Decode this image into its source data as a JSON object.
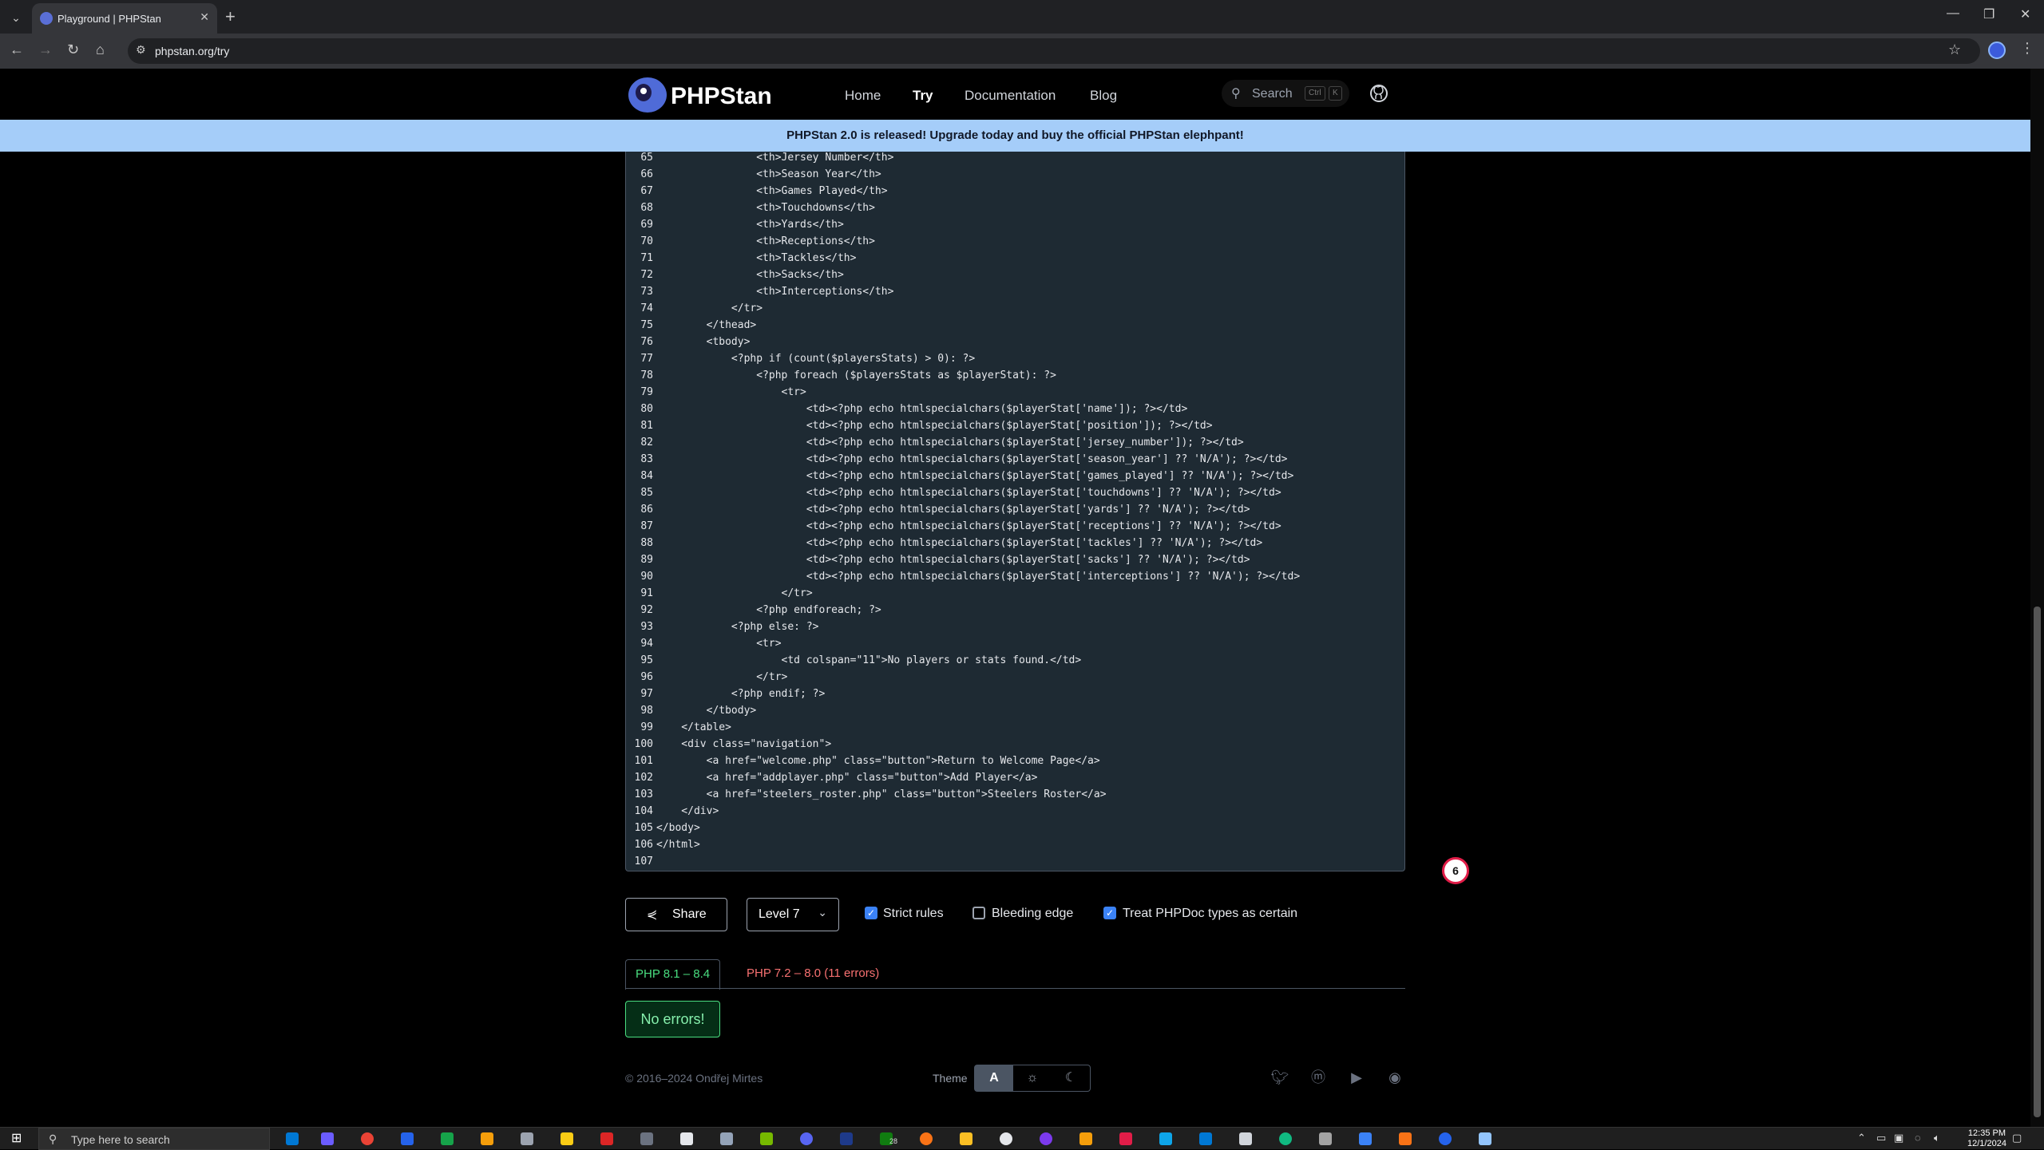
{
  "browser": {
    "tab_title": "Playground | PHPStan",
    "url": "phpstan.org/try"
  },
  "header": {
    "brand": "PHPStan",
    "nav": [
      "Home",
      "Try",
      "Documentation",
      "Blog"
    ],
    "search_placeholder": "Search",
    "search_key1": "Ctrl",
    "search_key2": "K"
  },
  "banner": "PHPStan 2.0 is released! Upgrade today and buy the official PHPStan elephpant!",
  "editor": {
    "lines": [
      {
        "n": "65",
        "t": "                <th>Jersey Number</th>"
      },
      {
        "n": "66",
        "t": "                <th>Season Year</th>"
      },
      {
        "n": "67",
        "t": "                <th>Games Played</th>"
      },
      {
        "n": "68",
        "t": "                <th>Touchdowns</th>"
      },
      {
        "n": "69",
        "t": "                <th>Yards</th>"
      },
      {
        "n": "70",
        "t": "                <th>Receptions</th>"
      },
      {
        "n": "71",
        "t": "                <th>Tackles</th>"
      },
      {
        "n": "72",
        "t": "                <th>Sacks</th>"
      },
      {
        "n": "73",
        "t": "                <th>Interceptions</th>"
      },
      {
        "n": "74",
        "t": "            </tr>"
      },
      {
        "n": "75",
        "t": "        </thead>"
      },
      {
        "n": "76",
        "t": "        <tbody>"
      },
      {
        "n": "77",
        "t": "            <?php if (count($playersStats) > 0): ?>"
      },
      {
        "n": "78",
        "t": "                <?php foreach ($playersStats as $playerStat): ?>"
      },
      {
        "n": "79",
        "t": "                    <tr>"
      },
      {
        "n": "80",
        "t": "                        <td><?php echo htmlspecialchars($playerStat['name']); ?></td>"
      },
      {
        "n": "81",
        "t": "                        <td><?php echo htmlspecialchars($playerStat['position']); ?></td>"
      },
      {
        "n": "82",
        "t": "                        <td><?php echo htmlspecialchars($playerStat['jersey_number']); ?></td>"
      },
      {
        "n": "83",
        "t": "                        <td><?php echo htmlspecialchars($playerStat['season_year'] ?? 'N/A'); ?></td>"
      },
      {
        "n": "84",
        "t": "                        <td><?php echo htmlspecialchars($playerStat['games_played'] ?? 'N/A'); ?></td>"
      },
      {
        "n": "85",
        "t": "                        <td><?php echo htmlspecialchars($playerStat['touchdowns'] ?? 'N/A'); ?></td>"
      },
      {
        "n": "86",
        "t": "                        <td><?php echo htmlspecialchars($playerStat['yards'] ?? 'N/A'); ?></td>"
      },
      {
        "n": "87",
        "t": "                        <td><?php echo htmlspecialchars($playerStat['receptions'] ?? 'N/A'); ?></td>"
      },
      {
        "n": "88",
        "t": "                        <td><?php echo htmlspecialchars($playerStat['tackles'] ?? 'N/A'); ?></td>"
      },
      {
        "n": "89",
        "t": "                        <td><?php echo htmlspecialchars($playerStat['sacks'] ?? 'N/A'); ?></td>"
      },
      {
        "n": "90",
        "t": "                        <td><?php echo htmlspecialchars($playerStat['interceptions'] ?? 'N/A'); ?></td>"
      },
      {
        "n": "91",
        "t": "                    </tr>"
      },
      {
        "n": "92",
        "t": "                <?php endforeach; ?>"
      },
      {
        "n": "93",
        "t": "            <?php else: ?>"
      },
      {
        "n": "94",
        "t": "                <tr>"
      },
      {
        "n": "95",
        "t": "                    <td colspan=\"11\">No players or stats found.</td>"
      },
      {
        "n": "96",
        "t": "                </tr>"
      },
      {
        "n": "97",
        "t": "            <?php endif; ?>"
      },
      {
        "n": "98",
        "t": "        </tbody>"
      },
      {
        "n": "99",
        "t": "    </table>"
      },
      {
        "n": "100",
        "t": "    <div class=\"navigation\">"
      },
      {
        "n": "101",
        "t": "        <a href=\"welcome.php\" class=\"button\">Return to Welcome Page</a>"
      },
      {
        "n": "102",
        "t": "        <a href=\"addplayer.php\" class=\"button\">Add Player</a>"
      },
      {
        "n": "103",
        "t": "        <a href=\"steelers_roster.php\" class=\"button\">Steelers Roster</a>"
      },
      {
        "n": "104",
        "t": "    </div>"
      },
      {
        "n": "105",
        "t": "</body>"
      },
      {
        "n": "106",
        "t": "</html>"
      },
      {
        "n": "107",
        "t": ""
      }
    ]
  },
  "notification_count": "6",
  "controls": {
    "share_label": "Share",
    "level_label": "Level 7",
    "strict_rules": "Strict rules",
    "bleeding_edge": "Bleeding edge",
    "treat_phpdoc": "Treat PHPDoc types as certain"
  },
  "results": {
    "tab_ok": "PHP 8.1 – 8.4",
    "tab_err": "PHP 7.2 – 8.0 (11 errors)",
    "status": "No errors!"
  },
  "footer": {
    "copyright": "© 2016–2024 Ondřej Mirtes",
    "theme_label": "Theme",
    "theme_auto": "A"
  },
  "taskbar": {
    "search_placeholder": "Type here to search",
    "time": "12:35 PM",
    "date": "12/1/2024",
    "badge": "28"
  },
  "colors": {
    "accent": "#a5cdf9",
    "success": "#4ade80",
    "error": "#f87171",
    "editor_bg": "#1e2a33"
  }
}
